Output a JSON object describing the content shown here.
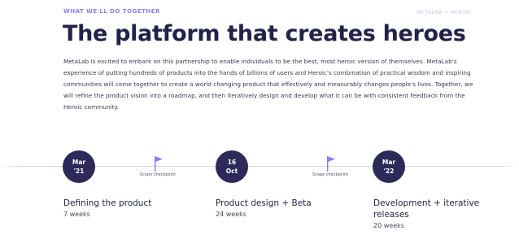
{
  "header": {
    "eyebrow": "WHAT WE'LL DO TOGETHER",
    "tag": "METALAB + HEROIC"
  },
  "title": "The platform that creates heroes",
  "body": "MetaLab is excited to embark on this partnership to enable individuals to be the best, most heroic version of themselves. MetaLab's experience of putting hundreds of products into the hands of billions of users and Heroic's combination of practical wisdom and inspiring communities will come together to create a world changing product that effectively and measurably changes people's lives. Together, we will refine the product vision into a roadmap, and then iteratively design and develop what it can be with consistent feedback from the Heroic community.",
  "timeline": {
    "nodes": [
      {
        "line1": "Mar",
        "line2": "'21"
      },
      {
        "line1": "16",
        "line2": "Oct"
      },
      {
        "line1": "Mar",
        "line2": "'22"
      }
    ],
    "checkpoints": [
      {
        "label": "Scope checkpoint",
        "icon": "flag-icon"
      },
      {
        "label": "Scope checkpoint",
        "icon": "flag-icon"
      }
    ],
    "phases": [
      {
        "title": "Defining the product",
        "duration": "7 weeks"
      },
      {
        "title": "Product design + Beta",
        "duration": "24 weeks"
      },
      {
        "title": "Development + iterative releases",
        "duration": "20 weeks"
      }
    ]
  },
  "colors": {
    "accent": "#8c7cf0",
    "node": "#2d2a5a",
    "flag": "#8a7cf2",
    "heading": "#23224a"
  }
}
